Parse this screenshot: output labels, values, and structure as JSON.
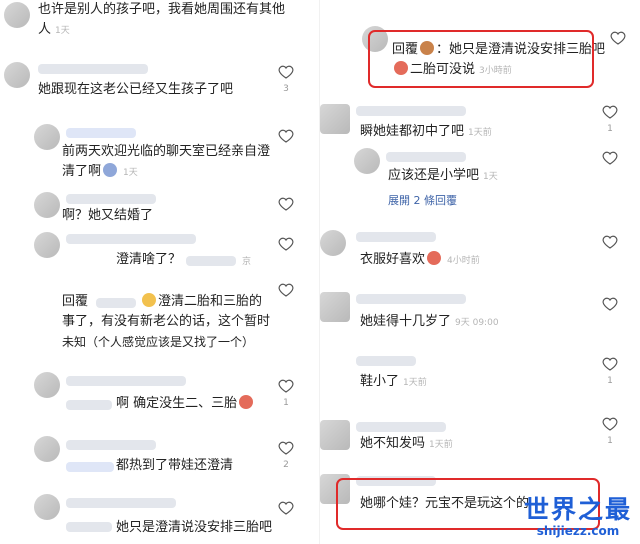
{
  "left_comments": [
    {
      "text": "也许是别人的孩子吧，我看她周围还有其他",
      "text2": "人",
      "meta": "1天",
      "count": ""
    },
    {
      "text": "她跟现在这老公已经又生孩子了吧",
      "meta": "",
      "count": "3"
    },
    {
      "text": "前两天欢迎光临的聊天室已经亲自澄",
      "text2": "清了啊",
      "meta": "1天",
      "count": ""
    },
    {
      "text": "啊？她又结婚了",
      "meta": "",
      "count": ""
    },
    {
      "text": "澄清啥了？",
      "meta": "京",
      "count": ""
    },
    {
      "prefix": "回覆",
      "text": "澄清二胎和三胎的",
      "text2": "事了，有没有新老公的话，这个暂时",
      "text3": "未知（个人感觉应该是又找了一个）",
      "count": ""
    },
    {
      "text": "啊 确定没生二、三胎",
      "meta": "",
      "count": "1"
    },
    {
      "text": "都热到了带娃还澄清",
      "meta": "",
      "count": "2"
    },
    {
      "text": "她只是澄清说没安排三胎吧",
      "meta": "",
      "count": ""
    }
  ],
  "right_comments": [
    {
      "prefix": "回覆",
      "text": "：她只是澄清说没安排三胎吧",
      "text2": "二胎可没说",
      "meta": "3小時前",
      "count": ""
    },
    {
      "text": "瞬她娃都初中了吧",
      "meta": "1天前",
      "count": "1"
    },
    {
      "text": "应该还是小学吧",
      "meta": "1天",
      "count": ""
    },
    {
      "text": "衣服好喜欢",
      "meta": "4小时前",
      "count": ""
    },
    {
      "text": "她娃得十几岁了",
      "meta": "9天 09:00",
      "count": ""
    },
    {
      "text": "鞋小了",
      "meta": "1天前",
      "count": "1"
    },
    {
      "text": "她不知发吗",
      "meta": "1天前",
      "count": "1"
    },
    {
      "text": "她哪个娃？元宝不是玩这个的",
      "meta": "",
      "count": ""
    }
  ],
  "replies_link": "展開 2 條回覆",
  "watermark": {
    "title": "世界之最",
    "url": "shijiezz.com"
  },
  "colors": {
    "highlight": "#e02a2a",
    "link": "#3f64a8",
    "watermark": "#1f5fd6"
  }
}
